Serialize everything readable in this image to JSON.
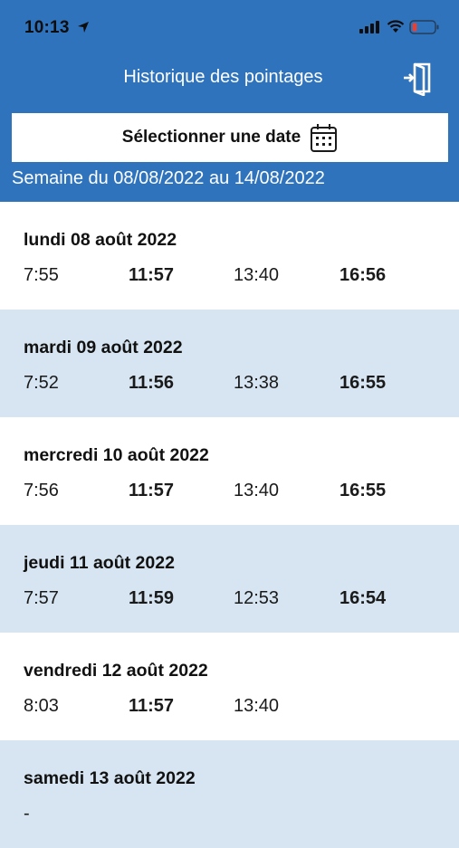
{
  "status_bar": {
    "time": "10:13"
  },
  "nav": {
    "title": "Historique des pointages"
  },
  "date_picker": {
    "label": "Sélectionner une date"
  },
  "week": {
    "label": "Semaine du 08/08/2022 au 14/08/2022"
  },
  "days": [
    {
      "title": "lundi 08 août 2022",
      "times": [
        "7:55",
        "11:57",
        "13:40",
        "16:56"
      ]
    },
    {
      "title": "mardi 09 août 2022",
      "times": [
        "7:52",
        "11:56",
        "13:38",
        "16:55"
      ]
    },
    {
      "title": "mercredi 10 août 2022",
      "times": [
        "7:56",
        "11:57",
        "13:40",
        "16:55"
      ]
    },
    {
      "title": "jeudi 11 août 2022",
      "times": [
        "7:57",
        "11:59",
        "12:53",
        "16:54"
      ]
    },
    {
      "title": "vendredi 12 août 2022",
      "times": [
        "8:03",
        "11:57",
        "13:40",
        ""
      ]
    },
    {
      "title": "samedi 13 août 2022",
      "times": [
        "-",
        "",
        "",
        ""
      ]
    }
  ],
  "colors": {
    "header": "#2f73bd",
    "alt_row": "#d6e5f1",
    "battery_low": "#e0433a"
  },
  "icons": {
    "exit": "door-exit-icon",
    "calendar": "calendar-icon",
    "location": "location-arrow-icon",
    "signal": "cellular-signal-icon",
    "wifi": "wifi-icon",
    "battery": "battery-low-icon"
  }
}
